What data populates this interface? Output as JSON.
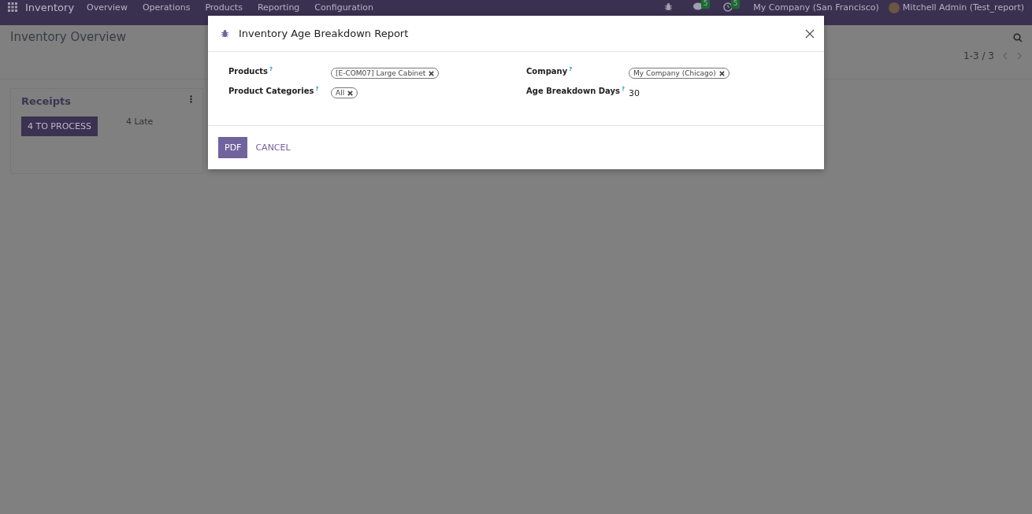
{
  "navbar": {
    "app": "Inventory",
    "menu": [
      "Overview",
      "Operations",
      "Products",
      "Reporting",
      "Configuration"
    ],
    "messages_badge": "5",
    "activities_badge": "5",
    "company": "My Company (San Francisco)",
    "user": "Mitchell Admin (Test_report)"
  },
  "control_panel": {
    "title": "Inventory Overview",
    "pager": "1-3 / 3"
  },
  "cards": [
    {
      "title": "Receipts",
      "button": "4 TO PROCESS",
      "late": "4 Late"
    }
  ],
  "dialog": {
    "title": "Inventory Age Breakdown Report",
    "fields": [
      {
        "label": "Products",
        "help": "?",
        "kind": "tags",
        "tags": [
          "[E-COM07] Large Cabinet"
        ]
      },
      {
        "label": "Company",
        "help": "?",
        "kind": "tags",
        "tags": [
          "My Company (Chicago)"
        ]
      },
      {
        "label": "Product Categories",
        "help": "?",
        "kind": "tags",
        "tags": [
          "All"
        ]
      },
      {
        "label": "Age Breakdown Days",
        "help": "?",
        "kind": "text",
        "value": "30"
      }
    ],
    "buttons": [
      {
        "label": "PDF",
        "kind": "primary"
      },
      {
        "label": "CANCEL",
        "kind": "link"
      }
    ]
  }
}
